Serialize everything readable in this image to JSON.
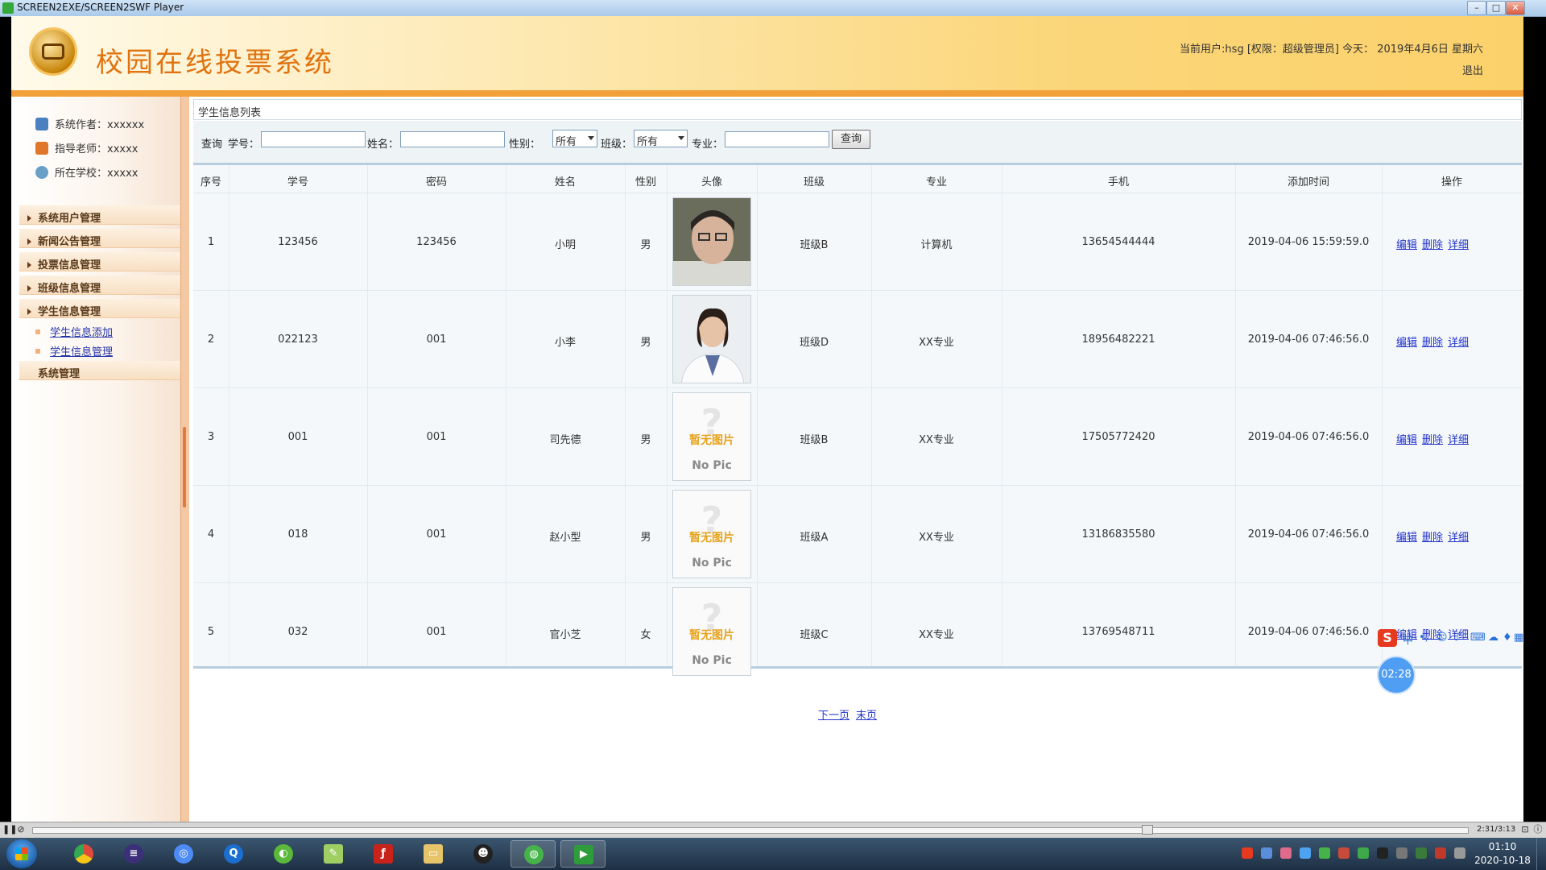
{
  "window": {
    "title": "SCREEN2EXE/SCREEN2SWF Player",
    "min": "–",
    "max": "□",
    "close": "✕"
  },
  "header": {
    "title": "校园在线投票系统",
    "user_info": "当前用户:hsg [权限：超级管理员] 今天： 2019年4月6日 星期六",
    "logout": "退出"
  },
  "sidebar": {
    "info": [
      {
        "label": "系统作者：xxxxxx",
        "icon": "people-icon",
        "color": "#4a7fc0"
      },
      {
        "label": "指导老师：xxxxx",
        "icon": "teacher-icon",
        "color": "#e0762a"
      },
      {
        "label": "所在学校：xxxxx",
        "icon": "globe-icon",
        "color": "#6aa0c8"
      }
    ],
    "menus": [
      "系统用户管理",
      "新闻公告管理",
      "投票信息管理",
      "班级信息管理",
      "学生信息管理"
    ],
    "submenus": [
      "学生信息添加",
      "学生信息管理"
    ],
    "last_menu": "系统管理"
  },
  "main": {
    "list_title": "学生信息列表",
    "search": {
      "prefix": "查询",
      "id_label": "学号：",
      "name_label": "姓名：",
      "gender_label": "性别：",
      "gender_value": "所有",
      "class_label": "班级：",
      "class_value": "所有",
      "major_label": "专业：",
      "button": "查询"
    },
    "columns": [
      "序号",
      "学号",
      "密码",
      "姓名",
      "性别",
      "头像",
      "班级",
      "专业",
      "手机",
      "添加时间",
      "操作"
    ],
    "rows": [
      {
        "no": "1",
        "id": "123456",
        "pwd": "123456",
        "name": "小明",
        "gender": "男",
        "photo": "photo-boy",
        "class": "班级B",
        "major": "计算机",
        "phone": "13654544444",
        "time": "2019-04-06 15:59:59.0"
      },
      {
        "no": "2",
        "id": "022123",
        "pwd": "001",
        "name": "小李",
        "gender": "男",
        "photo": "photo-doctor",
        "class": "班级D",
        "major": "XX专业",
        "phone": "18956482221",
        "time": "2019-04-06 07:46:56.0"
      },
      {
        "no": "3",
        "id": "001",
        "pwd": "001",
        "name": "司先德",
        "gender": "男",
        "photo": "no-pic",
        "class": "班级B",
        "major": "XX专业",
        "phone": "17505772420",
        "time": "2019-04-06 07:46:56.0"
      },
      {
        "no": "4",
        "id": "018",
        "pwd": "001",
        "name": "赵小型",
        "gender": "男",
        "photo": "no-pic",
        "class": "班级A",
        "major": "XX专业",
        "phone": "13186835580",
        "time": "2019-04-06 07:46:56.0"
      },
      {
        "no": "5",
        "id": "032",
        "pwd": "001",
        "name": "官小芝",
        "gender": "女",
        "photo": "no-pic",
        "class": "班级C",
        "major": "XX专业",
        "phone": "13769548711",
        "time": "2019-04-06 07:46:56.0"
      }
    ],
    "ops": [
      "编辑",
      "删除",
      "详细"
    ],
    "no_pic_cn": "暂无图片",
    "no_pic_en": "No Pic",
    "pager": [
      "下一页",
      "末页"
    ]
  },
  "overlay": {
    "ime_logo": "S",
    "ime_mode": "中",
    "timer": "02:28"
  },
  "player": {
    "time": "2:31/3:13"
  },
  "taskbar": {
    "apps": [
      "chrome",
      "eclipse",
      "baidu-netdisk",
      "browser",
      "360",
      "notepad",
      "flash",
      "explorer",
      "qq",
      "wechat",
      "screen-player"
    ],
    "clock_time": "01:10",
    "clock_date": "2020-10-18"
  }
}
